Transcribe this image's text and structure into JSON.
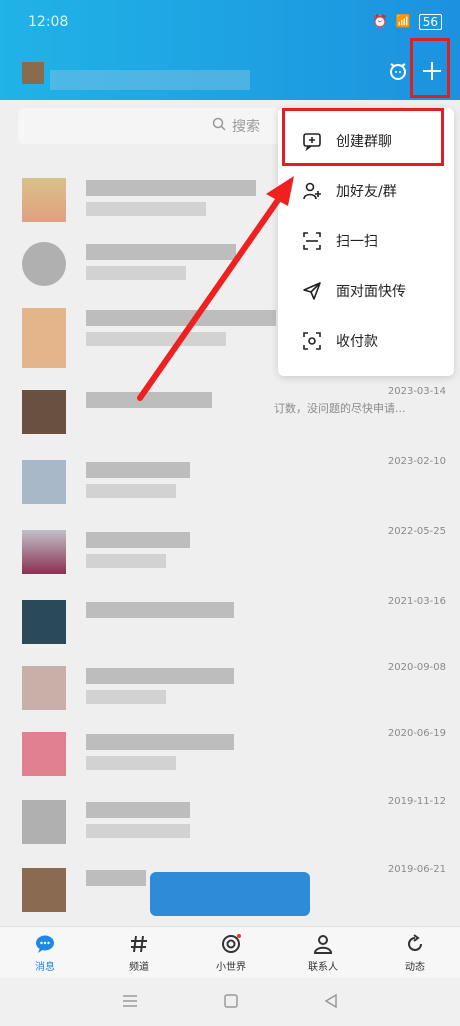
{
  "statusbar": {
    "time": "12:08",
    "battery": "56"
  },
  "search": {
    "placeholder": "搜索"
  },
  "menu": {
    "items": [
      {
        "label": "创建群聊",
        "icon": "message-plus-icon"
      },
      {
        "label": "加好友/群",
        "icon": "add-user-icon"
      },
      {
        "label": "扫一扫",
        "icon": "scan-icon"
      },
      {
        "label": "面对面快传",
        "icon": "send-icon"
      },
      {
        "label": "收付款",
        "icon": "payment-scan-icon"
      }
    ]
  },
  "conversations": [
    {
      "date": ""
    },
    {
      "date": ""
    },
    {
      "date": ""
    },
    {
      "date": "2023-03-14",
      "preview": "订数，没问题的尽快申请..."
    },
    {
      "date": "2023-02-10"
    },
    {
      "date": "2022-05-25"
    },
    {
      "date": "2021-03-16"
    },
    {
      "date": "2020-09-08"
    },
    {
      "date": "2020-06-19"
    },
    {
      "date": "2019-11-12"
    },
    {
      "date": "2019-06-21"
    }
  ],
  "tabs": [
    {
      "label": "消息",
      "icon": "message-icon"
    },
    {
      "label": "频道",
      "icon": "hash-icon"
    },
    {
      "label": "小世界",
      "icon": "world-icon"
    },
    {
      "label": "联系人",
      "icon": "contacts-icon"
    },
    {
      "label": "动态",
      "icon": "refresh-icon"
    }
  ],
  "colors": {
    "header": "#1c92df",
    "highlight": "#e02020",
    "activeTab": "#1e88e5"
  }
}
